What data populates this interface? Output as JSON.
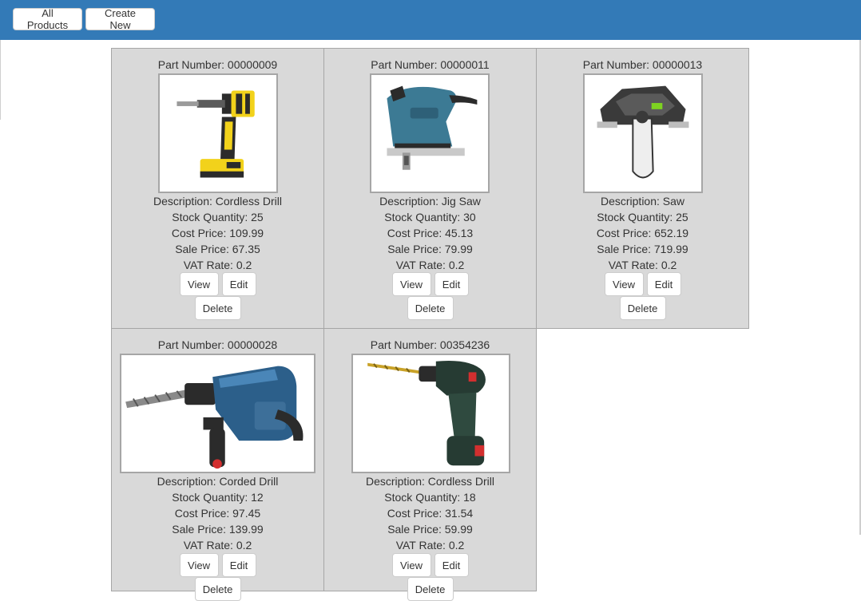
{
  "header": {
    "all_products_label": "All Products",
    "create_new_label": "Create New"
  },
  "products": [
    {
      "part_number": "Part Number: 00000009",
      "image_icon": "cordless-drill-yellow",
      "description": "Description: Cordless Drill",
      "stock_quantity": "Stock Quantity: 25",
      "cost_price": "Cost Price: 109.99",
      "sale_price": "Sale Price: 67.35",
      "vat_rate": "VAT Rate: 0.2",
      "view_label": "View",
      "edit_label": "Edit",
      "delete_label": "Delete"
    },
    {
      "part_number": "Part Number: 00000011",
      "image_icon": "jig-saw",
      "description": "Description: Jig Saw",
      "stock_quantity": "Stock Quantity: 30",
      "cost_price": "Cost Price: 45.13",
      "sale_price": "Sale Price: 79.99",
      "vat_rate": "VAT Rate: 0.2",
      "view_label": "View",
      "edit_label": "Edit",
      "delete_label": "Delete"
    },
    {
      "part_number": "Part Number: 00000013",
      "image_icon": "chain-saw",
      "description": "Description: Saw",
      "stock_quantity": "Stock Quantity: 25",
      "cost_price": "Cost Price: 652.19",
      "sale_price": "Sale Price: 719.99",
      "vat_rate": "VAT Rate: 0.2",
      "view_label": "View",
      "edit_label": "Edit",
      "delete_label": "Delete"
    },
    {
      "part_number": "Part Number: 00000028",
      "image_icon": "corded-hammer-drill",
      "description": "Description: Corded Drill",
      "stock_quantity": "Stock Quantity: 12",
      "cost_price": "Cost Price: 97.45",
      "sale_price": "Sale Price: 139.99",
      "vat_rate": "VAT Rate: 0.2",
      "view_label": "View",
      "edit_label": "Edit",
      "delete_label": "Delete"
    },
    {
      "part_number": "Part Number: 00354236",
      "image_icon": "cordless-drill-green",
      "description": "Description: Cordless Drill",
      "stock_quantity": "Stock Quantity: 18",
      "cost_price": "Cost Price: 31.54",
      "sale_price": "Sale Price: 59.99",
      "vat_rate": "VAT Rate: 0.2",
      "view_label": "View",
      "edit_label": "Edit",
      "delete_label": "Delete"
    }
  ],
  "colors": {
    "navbar": "#337ab7",
    "card_background": "#d9d9d9",
    "card_border": "#a6a6a6"
  }
}
